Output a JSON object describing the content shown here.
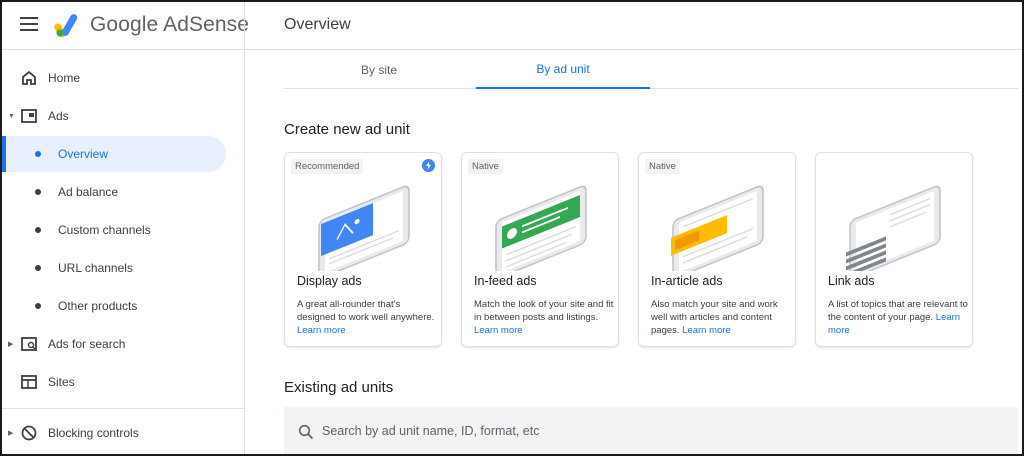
{
  "app": {
    "brand": "Google AdSense",
    "page_title": "Overview",
    "logo_colors": [
      "#fbbc04",
      "#34a853",
      "#4285f4"
    ]
  },
  "sidebar": {
    "items": [
      {
        "label": "Home",
        "icon": "home-icon",
        "type": "top"
      },
      {
        "label": "Ads",
        "icon": "ads-icon",
        "type": "top",
        "caret": "expanded"
      },
      {
        "label": "Overview",
        "type": "sub",
        "active": true
      },
      {
        "label": "Ad balance",
        "type": "sub"
      },
      {
        "label": "Custom channels",
        "type": "sub"
      },
      {
        "label": "URL channels",
        "type": "sub"
      },
      {
        "label": "Other products",
        "type": "sub"
      },
      {
        "label": "Ads for search",
        "icon": "search-ads-icon",
        "type": "top",
        "caret": "collapsed"
      },
      {
        "label": "Sites",
        "icon": "sites-icon",
        "type": "top"
      },
      {
        "label": "Blocking controls",
        "icon": "block-icon",
        "type": "top",
        "caret": "collapsed"
      }
    ]
  },
  "tabs": [
    {
      "label": "By site",
      "active": false
    },
    {
      "label": "By ad unit",
      "active": true
    }
  ],
  "create_section": {
    "title": "Create new ad unit",
    "cards": [
      {
        "tag": "Recommended",
        "title": "Display ads",
        "desc": "A great all-rounder that's designed to work well anywhere.",
        "link": "Learn more",
        "accent": "#4285f4",
        "illustration": "display-ads-illustration"
      },
      {
        "tag": "Native",
        "title": "In-feed ads",
        "desc": "Match the look of your site and fit in between posts and listings.",
        "link": "Learn more",
        "accent": "#34a853",
        "illustration": "in-feed-ads-illustration"
      },
      {
        "tag": "Native",
        "title": "In-article ads",
        "desc": "Also match your site and work well with articles and content pages.",
        "link": "Learn more",
        "accent": "#fbbc04",
        "illustration": "in-article-ads-illustration"
      },
      {
        "tag": "",
        "title": "Link ads",
        "desc": "A list of topics that are relevant to the content of your page.",
        "link": "Learn more",
        "accent": "#80868b",
        "illustration": "link-ads-illustration"
      }
    ]
  },
  "existing_section": {
    "title": "Existing ad units",
    "search_placeholder": "Search by ad unit name, ID, format, etc"
  },
  "colors": {
    "accent": "#1a73e8",
    "active_bg": "#e8f0fe",
    "text": "#202124",
    "muted": "#5f6368"
  }
}
